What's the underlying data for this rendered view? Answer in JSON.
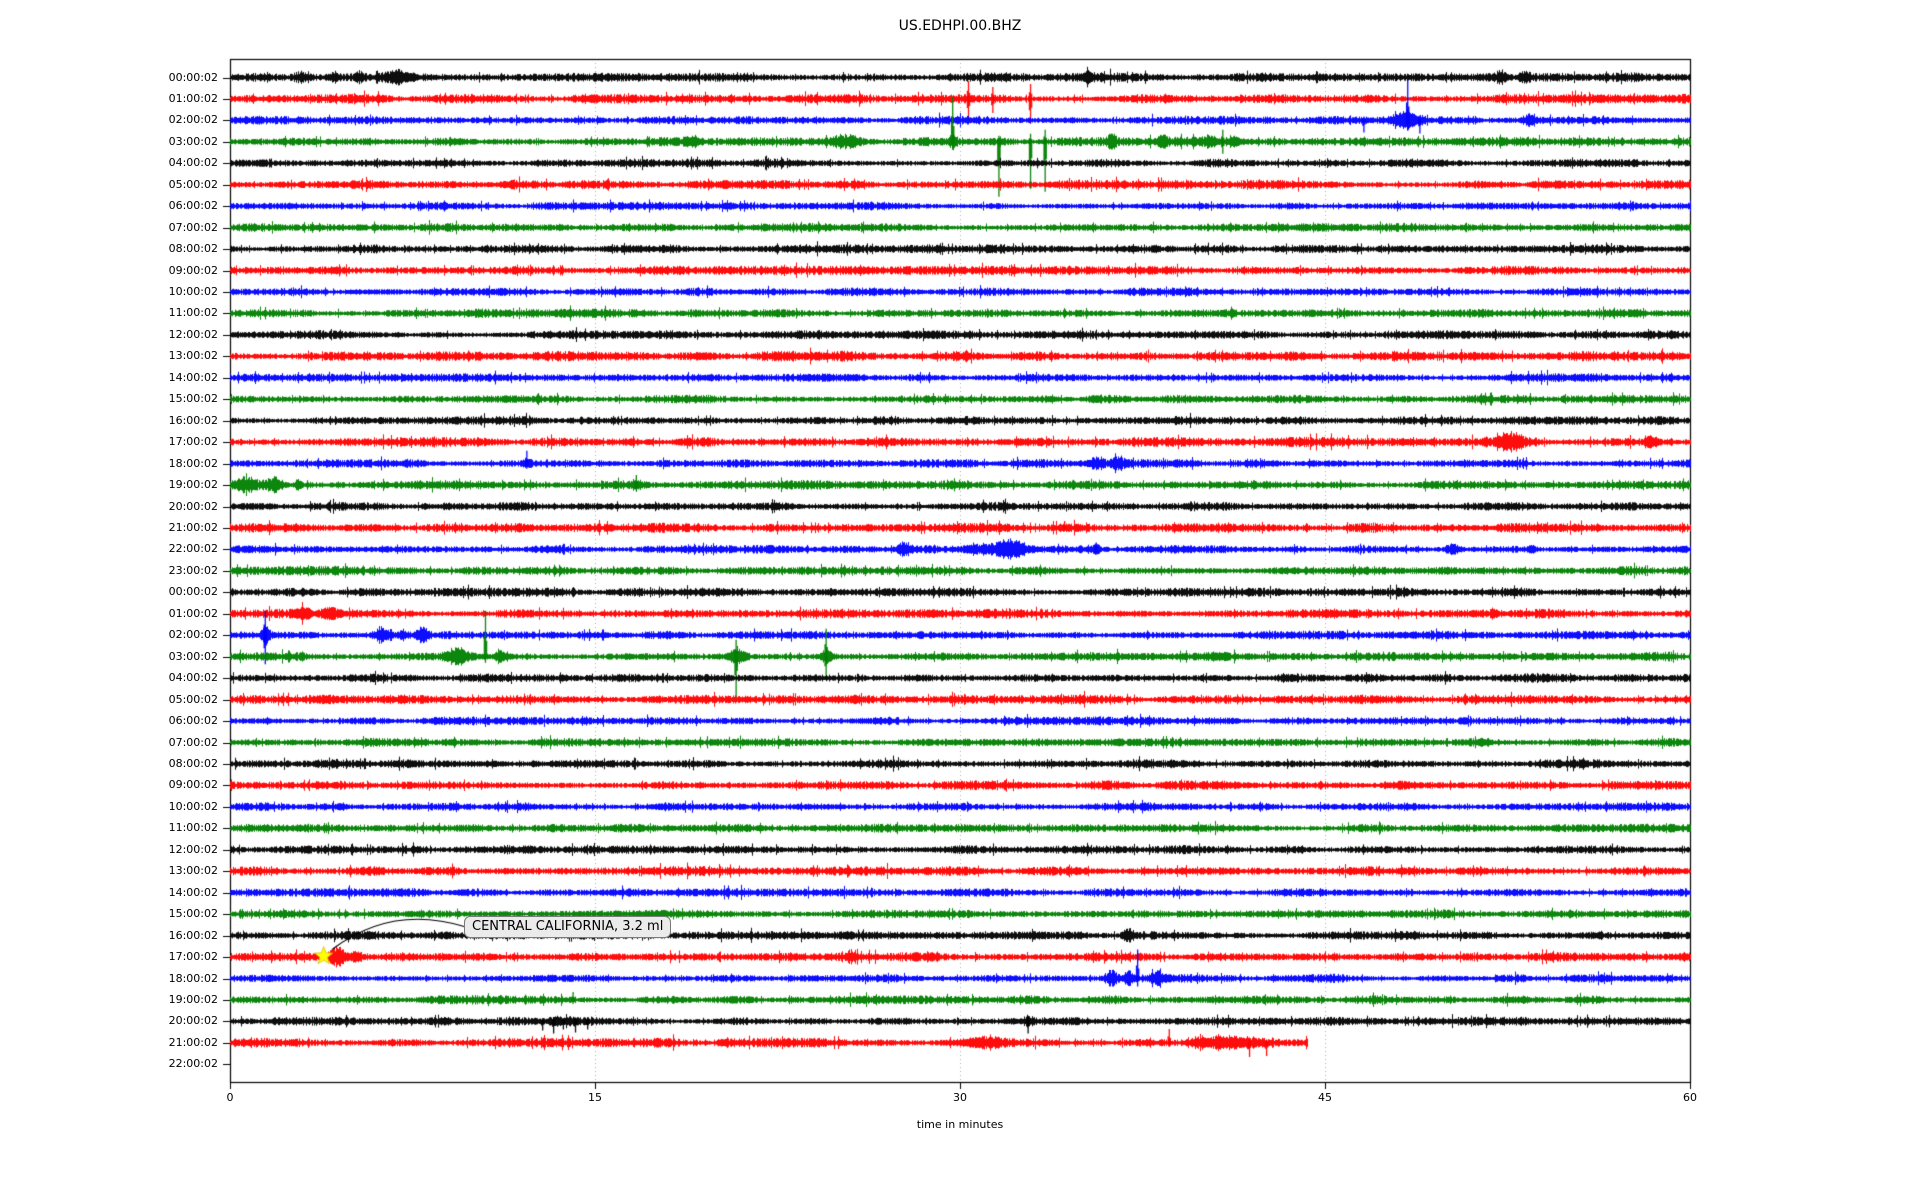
{
  "chart_data": {
    "type": "line",
    "subtype": "helicorder-seismogram",
    "title": "US.EDHPI.00.BHZ",
    "xlabel": "time in minutes",
    "xlim": [
      0,
      60
    ],
    "x_ticks": [
      0,
      15,
      30,
      45,
      60
    ],
    "grid": "vertical dotted gridlines at 15, 30, 45 minutes",
    "legend": "none",
    "trace_colors": {
      "black": "#000000",
      "red": "#ff0000",
      "blue": "#0000ff",
      "green": "#008000"
    },
    "annotation": {
      "text": "CENTRAL CALIFORNIA, 3.2 ml",
      "target_row_index": 41,
      "target_row_label": "17:00:02",
      "target_minute": 3.85,
      "marker": "yellow-star"
    },
    "rows": [
      {
        "label": "00:00:02",
        "color": "black",
        "noise": 2.8,
        "events": [
          {
            "m": 2.9,
            "t": "burst",
            "a": 4,
            "w": 0.5
          },
          {
            "m": 4.3,
            "t": "burst",
            "a": 3,
            "w": 0.3
          },
          {
            "m": 5.3,
            "t": "burst",
            "a": 3,
            "w": 0.3
          },
          {
            "m": 6.9,
            "t": "burst",
            "a": 4,
            "w": 0.9
          },
          {
            "m": 35.2,
            "t": "burst",
            "a": 2.5,
            "w": 0.4
          },
          {
            "m": 52.2,
            "t": "burst",
            "a": 3.5,
            "w": 0.5
          },
          {
            "m": 53.2,
            "t": "burst",
            "a": 3.5,
            "w": 0.4
          }
        ]
      },
      {
        "label": "01:00:02",
        "color": "red",
        "noise": 2.8,
        "events": [
          {
            "m": 30.35,
            "t": "spike",
            "u": 18,
            "d": 20
          },
          {
            "m": 31.35,
            "t": "spike",
            "u": 12,
            "d": 14
          },
          {
            "m": 32.9,
            "t": "spike",
            "u": 15,
            "d": 25
          }
        ]
      },
      {
        "label": "02:00:02",
        "color": "blue",
        "noise": 2.6,
        "events": [
          {
            "m": 46.6,
            "t": "spike",
            "u": 4,
            "d": 12
          },
          {
            "m": 48.3,
            "t": "burst",
            "a": 6,
            "w": 0.8
          },
          {
            "m": 48.4,
            "t": "spike",
            "u": 40,
            "d": 10
          },
          {
            "m": 48.9,
            "t": "spike",
            "u": 5,
            "d": 13
          },
          {
            "m": 53.4,
            "t": "burst",
            "a": 5,
            "w": 0.5
          }
        ]
      },
      {
        "label": "03:00:02",
        "color": "green",
        "noise": 2.8,
        "events": [
          {
            "m": 19.0,
            "t": "burst",
            "a": 3,
            "w": 0.6
          },
          {
            "m": 25.3,
            "t": "burst",
            "a": 4.5,
            "w": 1.1
          },
          {
            "m": 29.7,
            "t": "burst",
            "a": 5,
            "w": 0.3
          },
          {
            "m": 29.7,
            "t": "spike",
            "u": 45,
            "d": 8
          },
          {
            "m": 31.6,
            "t": "spike",
            "u": 6,
            "d": 55
          },
          {
            "m": 32.9,
            "t": "spike",
            "u": 8,
            "d": 47
          },
          {
            "m": 33.5,
            "t": "spike",
            "u": 12,
            "d": 50
          },
          {
            "m": 36.2,
            "t": "burst",
            "a": 5,
            "w": 0.3
          },
          {
            "m": 38.3,
            "t": "burst",
            "a": 4,
            "w": 0.3
          },
          {
            "m": 40.2,
            "t": "burst",
            "a": 4,
            "w": 0.7
          },
          {
            "m": 40.8,
            "t": "spike",
            "u": 12,
            "d": 12
          },
          {
            "m": 41.2,
            "t": "burst",
            "a": 5,
            "w": 0.4
          }
        ]
      },
      {
        "label": "04:00:02",
        "color": "black",
        "noise": 2.6,
        "events": []
      },
      {
        "label": "05:00:02",
        "color": "red",
        "noise": 2.8,
        "events": []
      },
      {
        "label": "06:00:02",
        "color": "blue",
        "noise": 2.4,
        "events": []
      },
      {
        "label": "07:00:02",
        "color": "green",
        "noise": 2.6,
        "events": []
      },
      {
        "label": "08:00:02",
        "color": "black",
        "noise": 2.6,
        "events": []
      },
      {
        "label": "09:00:02",
        "color": "red",
        "noise": 2.8,
        "events": []
      },
      {
        "label": "10:00:02",
        "color": "blue",
        "noise": 2.5,
        "events": []
      },
      {
        "label": "11:00:02",
        "color": "green",
        "noise": 2.6,
        "events": []
      },
      {
        "label": "12:00:02",
        "color": "black",
        "noise": 2.6,
        "events": []
      },
      {
        "label": "13:00:02",
        "color": "red",
        "noise": 3.0,
        "events": []
      },
      {
        "label": "14:00:02",
        "color": "blue",
        "noise": 2.5,
        "events": []
      },
      {
        "label": "15:00:02",
        "color": "green",
        "noise": 2.7,
        "events": []
      },
      {
        "label": "16:00:02",
        "color": "black",
        "noise": 2.6,
        "events": []
      },
      {
        "label": "17:00:02",
        "color": "red",
        "noise": 2.9,
        "events": [
          {
            "m": 52.6,
            "t": "burst",
            "a": 7,
            "w": 0.9
          },
          {
            "m": 58.4,
            "t": "burst",
            "a": 4,
            "w": 0.4
          }
        ]
      },
      {
        "label": "18:00:02",
        "color": "blue",
        "noise": 2.5,
        "events": [
          {
            "m": 12.2,
            "t": "spike",
            "u": 13,
            "d": 5
          },
          {
            "m": 12.2,
            "t": "burst",
            "a": 3,
            "w": 0.3
          },
          {
            "m": 35.6,
            "t": "burst",
            "a": 4,
            "w": 0.5
          },
          {
            "m": 36.5,
            "t": "burst",
            "a": 4,
            "w": 0.5
          }
        ]
      },
      {
        "label": "19:00:02",
        "color": "green",
        "noise": 2.7,
        "events": [
          {
            "m": 0.6,
            "t": "burst",
            "a": 6,
            "w": 0.7
          },
          {
            "m": 1.8,
            "t": "burst",
            "a": 5,
            "w": 0.5
          },
          {
            "m": 2.8,
            "t": "burst",
            "a": 3,
            "w": 0.3
          },
          {
            "m": 16.7,
            "t": "spike",
            "u": 10,
            "d": 6
          },
          {
            "m": 16.7,
            "t": "burst",
            "a": 3,
            "w": 0.3
          }
        ]
      },
      {
        "label": "20:00:02",
        "color": "black",
        "noise": 2.6,
        "events": []
      },
      {
        "label": "21:00:02",
        "color": "red",
        "noise": 2.8,
        "events": [
          {
            "m": 34.3,
            "t": "spike",
            "u": 7,
            "d": 3
          }
        ]
      },
      {
        "label": "22:00:02",
        "color": "blue",
        "noise": 2.5,
        "events": [
          {
            "m": 27.7,
            "t": "burst",
            "a": 5,
            "w": 0.5
          },
          {
            "m": 31.5,
            "t": "burst",
            "a": 4,
            "w": 2.2
          },
          {
            "m": 32.2,
            "t": "burst",
            "a": 5,
            "w": 0.8
          },
          {
            "m": 35.6,
            "t": "spike",
            "u": 7,
            "d": 5
          },
          {
            "m": 35.6,
            "t": "burst",
            "a": 3,
            "w": 0.3
          },
          {
            "m": 50.2,
            "t": "burst",
            "a": 4,
            "w": 0.5
          },
          {
            "m": 53.5,
            "t": "burst",
            "a": 3,
            "w": 0.3
          }
        ]
      },
      {
        "label": "23:00:02",
        "color": "green",
        "noise": 2.7,
        "events": []
      },
      {
        "label": "00:00:02",
        "color": "black",
        "noise": 2.6,
        "events": []
      },
      {
        "label": "01:00:02",
        "color": "red",
        "noise": 2.8,
        "events": [
          {
            "m": 1.5,
            "t": "spike",
            "u": 4,
            "d": 4
          },
          {
            "m": 3.1,
            "t": "burst",
            "a": 4,
            "w": 0.4
          },
          {
            "m": 4.1,
            "t": "burst",
            "a": 5,
            "w": 0.7
          }
        ]
      },
      {
        "label": "02:00:02",
        "color": "blue",
        "noise": 2.5,
        "events": [
          {
            "m": 1.45,
            "t": "spike",
            "u": 24,
            "d": 29
          },
          {
            "m": 1.45,
            "t": "burst",
            "a": 6,
            "w": 0.3
          },
          {
            "m": 6.2,
            "t": "burst",
            "a": 6,
            "w": 0.5
          },
          {
            "m": 7.1,
            "t": "burst",
            "a": 3,
            "w": 0.3
          },
          {
            "m": 7.9,
            "t": "burst",
            "a": 5,
            "w": 0.4
          }
        ]
      },
      {
        "label": "03:00:02",
        "color": "green",
        "noise": 2.7,
        "events": [
          {
            "m": 9.35,
            "t": "burst",
            "a": 6,
            "w": 0.8
          },
          {
            "m": 10.5,
            "t": "spike",
            "u": 46,
            "d": 6
          },
          {
            "m": 11.1,
            "t": "burst",
            "a": 4,
            "w": 0.4
          },
          {
            "m": 20.8,
            "t": "burst",
            "a": 6,
            "w": 0.6
          },
          {
            "m": 20.8,
            "t": "spike",
            "u": 17,
            "d": 41
          },
          {
            "m": 24.5,
            "t": "spike",
            "u": 28,
            "d": 21
          },
          {
            "m": 24.5,
            "t": "burst",
            "a": 5,
            "w": 0.5
          }
        ]
      },
      {
        "label": "04:00:02",
        "color": "black",
        "noise": 2.6,
        "events": []
      },
      {
        "label": "05:00:02",
        "color": "red",
        "noise": 2.8,
        "events": []
      },
      {
        "label": "06:00:02",
        "color": "blue",
        "noise": 2.4,
        "events": []
      },
      {
        "label": "07:00:02",
        "color": "green",
        "noise": 2.6,
        "events": []
      },
      {
        "label": "08:00:02",
        "color": "black",
        "noise": 2.6,
        "events": []
      },
      {
        "label": "09:00:02",
        "color": "red",
        "noise": 2.8,
        "events": []
      },
      {
        "label": "10:00:02",
        "color": "blue",
        "noise": 2.5,
        "events": []
      },
      {
        "label": "11:00:02",
        "color": "green",
        "noise": 2.6,
        "events": []
      },
      {
        "label": "12:00:02",
        "color": "black",
        "noise": 2.7,
        "events": []
      },
      {
        "label": "13:00:02",
        "color": "red",
        "noise": 2.9,
        "events": []
      },
      {
        "label": "14:00:02",
        "color": "blue",
        "noise": 2.5,
        "events": []
      },
      {
        "label": "15:00:02",
        "color": "green",
        "noise": 2.6,
        "events": []
      },
      {
        "label": "16:00:02",
        "color": "black",
        "noise": 2.6,
        "events": [
          {
            "m": 36.9,
            "t": "burst",
            "a": 5,
            "w": 0.35
          }
        ]
      },
      {
        "label": "17:00:02",
        "color": "red",
        "noise": 2.8,
        "events": [
          {
            "m": 4.4,
            "t": "burst",
            "a": 7,
            "w": 0.6
          },
          {
            "m": 5.2,
            "t": "burst",
            "a": 4,
            "w": 0.4
          },
          {
            "m": 25.5,
            "t": "burst",
            "a": 3,
            "w": 0.3
          }
        ]
      },
      {
        "label": "18:00:02",
        "color": "blue",
        "noise": 2.5,
        "events": [
          {
            "m": 36.2,
            "t": "burst",
            "a": 6,
            "w": 0.5
          },
          {
            "m": 36.9,
            "t": "burst",
            "a": 5,
            "w": 0.4
          },
          {
            "m": 37.3,
            "t": "spike",
            "u": 29,
            "d": 8
          },
          {
            "m": 38.1,
            "t": "burst",
            "a": 5,
            "w": 0.5
          }
        ]
      },
      {
        "label": "19:00:02",
        "color": "green",
        "noise": 2.6,
        "events": [
          {
            "m": 14.1,
            "t": "spike",
            "u": 8,
            "d": 4
          }
        ]
      },
      {
        "label": "20:00:02",
        "color": "black",
        "noise": 2.6,
        "events": [
          {
            "m": 12.85,
            "t": "spike",
            "u": 3,
            "d": 9
          },
          {
            "m": 13.3,
            "t": "spike",
            "u": 4,
            "d": 12
          },
          {
            "m": 13.7,
            "t": "spike",
            "u": 3,
            "d": 8
          },
          {
            "m": 14.2,
            "t": "spike",
            "u": 4,
            "d": 11
          },
          {
            "m": 14.7,
            "t": "spike",
            "u": 3,
            "d": 8
          },
          {
            "m": 13.5,
            "t": "burst",
            "a": 3,
            "w": 1.0
          },
          {
            "m": 32.8,
            "t": "spike",
            "u": 5,
            "d": 12
          },
          {
            "m": 32.8,
            "t": "burst",
            "a": 3,
            "w": 0.3
          }
        ]
      },
      {
        "label": "21:00:02",
        "color": "red",
        "noise": 2.8,
        "end_minute": 44.3,
        "events": [
          {
            "m": 31.0,
            "t": "burst",
            "a": 3.5,
            "w": 1.5
          },
          {
            "m": 38.6,
            "t": "spike",
            "u": 14,
            "d": 4
          },
          {
            "m": 39.8,
            "t": "burst",
            "a": 4,
            "w": 0.6
          },
          {
            "m": 40.6,
            "t": "burst",
            "a": 4,
            "w": 0.5
          },
          {
            "m": 41.2,
            "t": "burst",
            "a": 4,
            "w": 0.6
          },
          {
            "m": 41.9,
            "t": "spike",
            "u": 3,
            "d": 14
          },
          {
            "m": 42.6,
            "t": "spike",
            "u": 3,
            "d": 13
          },
          {
            "m": 42.0,
            "t": "burst",
            "a": 3,
            "w": 0.8
          }
        ]
      },
      {
        "label": "22:00:02",
        "color": "black",
        "noise": 0,
        "no_trace": true,
        "events": []
      }
    ]
  }
}
